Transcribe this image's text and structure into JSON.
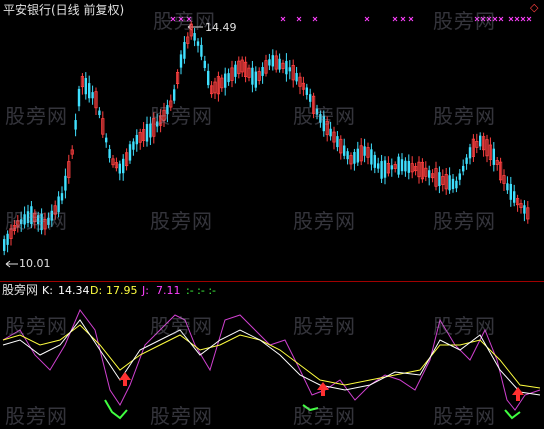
{
  "top_panel": {
    "title": "平安银行(日线 前复权)",
    "high_label": "14.49",
    "low_label": "10.01"
  },
  "indicator_panel": {
    "name": "股旁网",
    "k_label": "K:",
    "k_value": "14.34",
    "d_label": "D:",
    "d_value": "17.95",
    "j_label": "J:",
    "j_value": "7.11",
    "dashes": ":- :- :-"
  },
  "watermark": "股旁网",
  "colors": {
    "up": "#ff4040",
    "down": "#40e0ff",
    "magenta": "#ff40ff",
    "divider": "#a00000",
    "k_line": "#ffffff",
    "d_line": "#ffff40",
    "j_line": "#d040d0",
    "bottom_green": "#40ff40",
    "arrow": "#ff3030"
  }
}
